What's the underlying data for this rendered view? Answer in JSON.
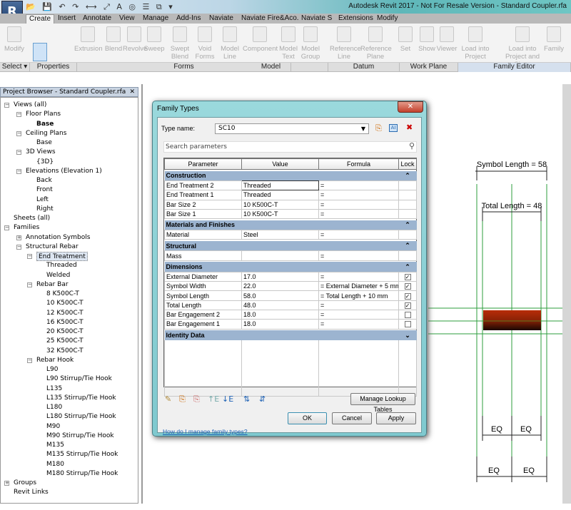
{
  "app": {
    "logo": "R",
    "title": "Autodesk Revit 2017 - Not For Resale Version -   Standard Coupler.rfa"
  },
  "tabs": [
    "Create",
    "Insert",
    "Annotate",
    "View",
    "Manage",
    "Add-Ins",
    "Naviate",
    "Naviate Fire&Aco.",
    "Naviate S",
    "Extensions",
    "Modify"
  ],
  "ribbon": {
    "buttons": [
      "Modify",
      "Extrusion",
      "Blend",
      "Revolve",
      "Sweep",
      "Swept Blend",
      "Void Forms",
      "Model Line",
      "Component",
      "Model Text",
      "Model Group",
      "Reference Line",
      "Reference Plane",
      "Set",
      "Show",
      "Viewer",
      "Load into Project",
      "Load into Project and Close",
      "Family"
    ],
    "panels": [
      "Select ▾",
      "Properties",
      "Forms",
      "Model",
      "Datum",
      "Work Plane",
      "Family Editor"
    ]
  },
  "browser": {
    "title": "Project Browser - Standard Coupler.rfa",
    "close": "✕",
    "items": [
      {
        "label": "Views (all)",
        "level": 0,
        "exp": "-"
      },
      {
        "label": "Floor Plans",
        "level": 1,
        "exp": "-"
      },
      {
        "label": "Base",
        "level": 2,
        "bold": true
      },
      {
        "label": "Ceiling Plans",
        "level": 1,
        "exp": "-"
      },
      {
        "label": "Base",
        "level": 2
      },
      {
        "label": "3D Views",
        "level": 1,
        "exp": "-"
      },
      {
        "label": "{3D}",
        "level": 2
      },
      {
        "label": "Elevations (Elevation 1)",
        "level": 1,
        "exp": "-"
      },
      {
        "label": "Back",
        "level": 2
      },
      {
        "label": "Front",
        "level": 2
      },
      {
        "label": "Left",
        "level": 2
      },
      {
        "label": "Right",
        "level": 2
      },
      {
        "label": "Sheets (all)",
        "level": 0
      },
      {
        "label": "Families",
        "level": 0,
        "exp": "-"
      },
      {
        "label": "Annotation Symbols",
        "level": 1,
        "exp": "+"
      },
      {
        "label": "Structural Rebar",
        "level": 1,
        "exp": "-"
      },
      {
        "label": "End Treatment",
        "level": 2,
        "exp": "-",
        "selected": true
      },
      {
        "label": "Threaded",
        "level": 3
      },
      {
        "label": "Welded",
        "level": 3
      },
      {
        "label": "Rebar Bar",
        "level": 2,
        "exp": "-"
      },
      {
        "label": "8 K500C-T",
        "level": 3
      },
      {
        "label": "10 K500C-T",
        "level": 3
      },
      {
        "label": "12 K500C-T",
        "level": 3
      },
      {
        "label": "16 K500C-T",
        "level": 3
      },
      {
        "label": "20 K500C-T",
        "level": 3
      },
      {
        "label": "25 K500C-T",
        "level": 3
      },
      {
        "label": "32 K500C-T",
        "level": 3
      },
      {
        "label": "Rebar Hook",
        "level": 2,
        "exp": "-"
      },
      {
        "label": "L90",
        "level": 3
      },
      {
        "label": "L90 Stirrup/Tie Hook",
        "level": 3
      },
      {
        "label": "L135",
        "level": 3
      },
      {
        "label": "L135 Stirrup/Tie Hook",
        "level": 3
      },
      {
        "label": "L180",
        "level": 3
      },
      {
        "label": "L180 Stirrup/Tie Hook",
        "level": 3
      },
      {
        "label": "M90",
        "level": 3
      },
      {
        "label": "M90 Stirrup/Tie Hook",
        "level": 3
      },
      {
        "label": "M135",
        "level": 3
      },
      {
        "label": "M135 Stirrup/Tie Hook",
        "level": 3
      },
      {
        "label": "M180",
        "level": 3
      },
      {
        "label": "M180 Stirrup/Tie Hook",
        "level": 3
      },
      {
        "label": "Groups",
        "level": 0,
        "exp": "+"
      },
      {
        "label": "Revit Links",
        "level": 0
      }
    ]
  },
  "dialog": {
    "title": "Family Types",
    "close": "✕",
    "type_name_label": "Type name:",
    "type_name_value": "SC10",
    "search_placeholder": "Search parameters",
    "columns": [
      "Parameter",
      "Value",
      "Formula",
      "Lock"
    ],
    "groups": [
      {
        "name": "Construction",
        "collapsed": false,
        "rows": [
          {
            "param": "End Treatment 2",
            "value": "Threaded",
            "formula": "=",
            "lock": null,
            "editing": true
          },
          {
            "param": "End Treatment 1",
            "value": "Threaded",
            "formula": "=",
            "lock": null
          },
          {
            "param": "Bar Size 2",
            "value": "10 K500C-T",
            "formula": "=",
            "lock": null
          },
          {
            "param": "Bar Size 1",
            "value": "10 K500C-T",
            "formula": "=",
            "lock": null
          }
        ]
      },
      {
        "name": "Materials and Finishes",
        "collapsed": false,
        "rows": [
          {
            "param": "Material",
            "value": "Steel",
            "formula": "=",
            "lock": null
          }
        ]
      },
      {
        "name": "Structural",
        "collapsed": false,
        "rows": [
          {
            "param": "Mass",
            "value": "",
            "formula": "=",
            "lock": null
          }
        ]
      },
      {
        "name": "Dimensions",
        "collapsed": false,
        "rows": [
          {
            "param": "External Diameter",
            "value": "17.0",
            "formula": "=",
            "lock": true
          },
          {
            "param": "Symbol Width",
            "value": "22.0",
            "formula": "= External Diameter + 5 mm",
            "lock": true
          },
          {
            "param": "Symbol Length",
            "value": "58.0",
            "formula": "= Total Length + 10 mm",
            "lock": true
          },
          {
            "param": "Total Length",
            "value": "48.0",
            "formula": "=",
            "lock": true
          },
          {
            "param": "Bar Engagement 2",
            "value": "18.0",
            "formula": "=",
            "lock": false
          },
          {
            "param": "Bar Engagement 1",
            "value": "18.0",
            "formula": "=",
            "lock": false
          }
        ]
      },
      {
        "name": "Identity Data",
        "collapsed": true,
        "rows": []
      }
    ],
    "manage_lookup": "Manage Lookup Tables",
    "help_link": "How do I manage family types?",
    "ok": "OK",
    "cancel": "Cancel",
    "apply": "Apply"
  },
  "drawing": {
    "symbol_length": "Symbol Length = 58",
    "total_length": "Total Length = 48",
    "eq": "EQ",
    "line_color": "#2e9e3e",
    "bar_color": "#b02a08"
  }
}
